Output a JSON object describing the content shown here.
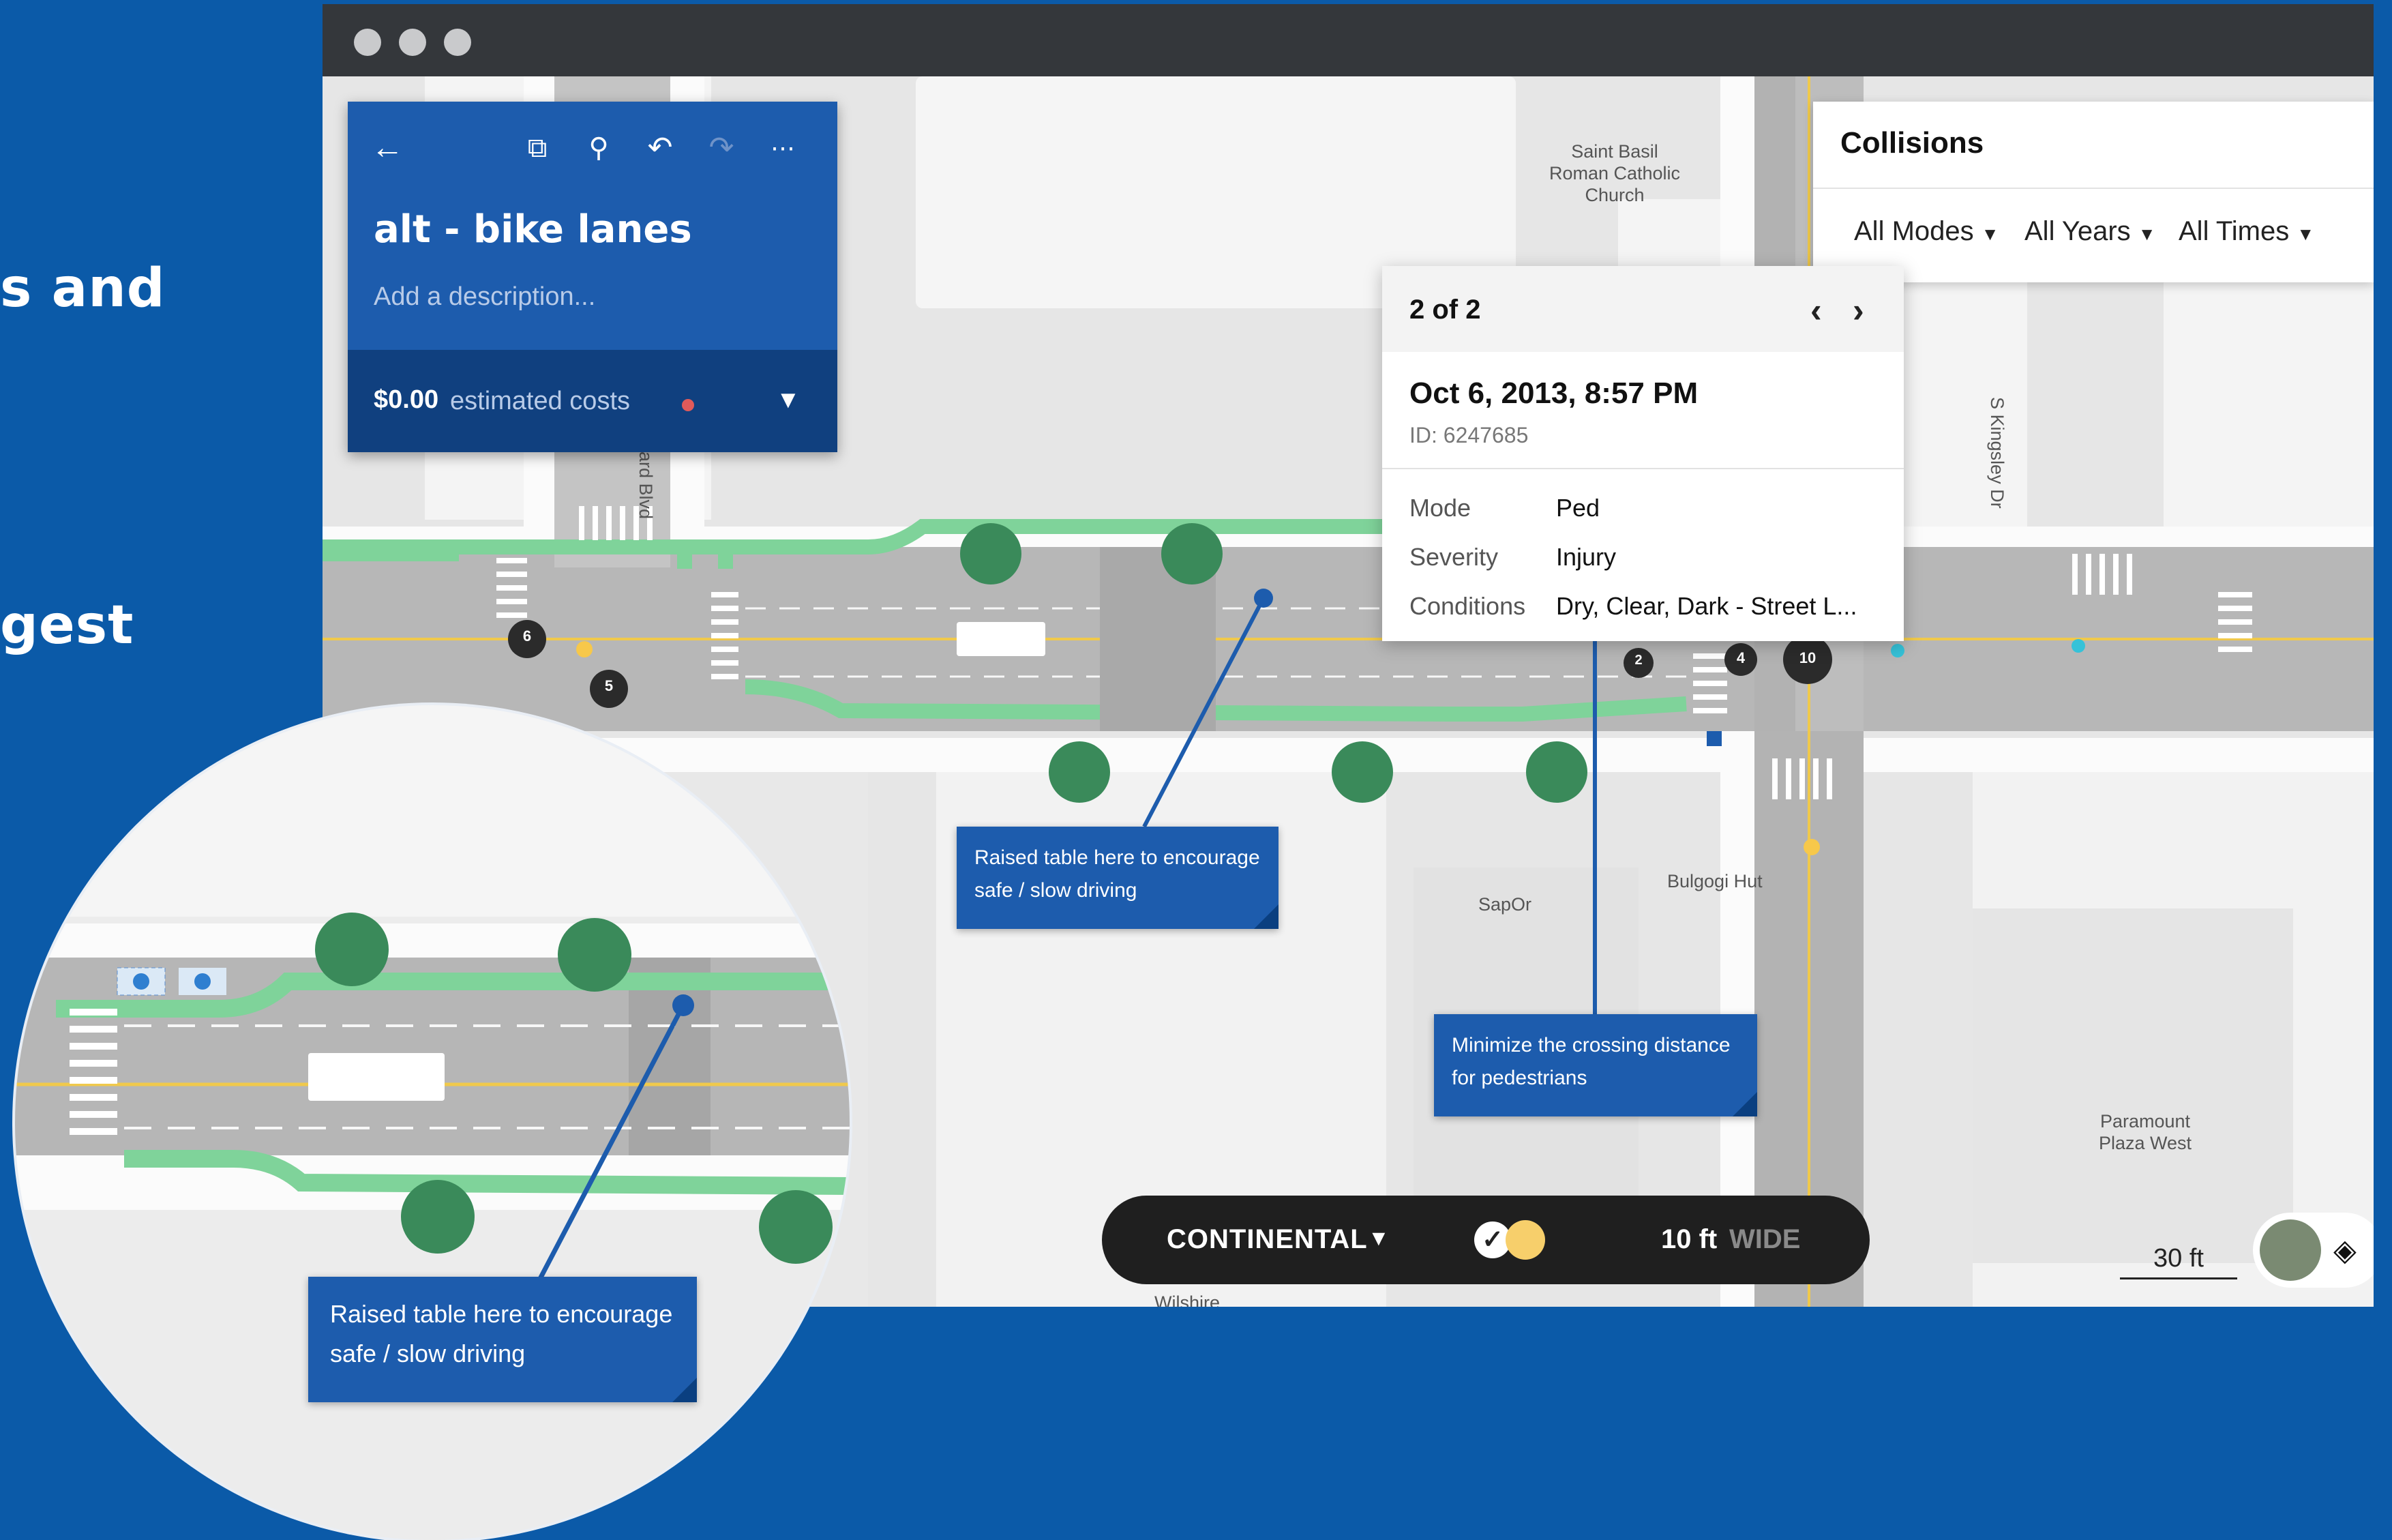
{
  "background_text": {
    "line1": "s and",
    "line2": "gest"
  },
  "project": {
    "back_icon": "arrow-left-icon",
    "toolbar_icons": [
      "duplicate-icon",
      "search-icon",
      "undo-icon",
      "redo-icon",
      "more-icon"
    ],
    "title": "alt - bike lanes",
    "description_placeholder": "Add a description...",
    "cost_value": "$0.00",
    "cost_label": "estimated costs"
  },
  "collisions": {
    "title": "Collisions",
    "filters": {
      "modes": "All Modes",
      "years": "All Years",
      "times": "All Times"
    }
  },
  "popup": {
    "count": "2 of 2",
    "date": "Oct 6, 2013, 8:57 PM",
    "id": "ID: 6247685",
    "rows": [
      {
        "key": "Mode",
        "value": "Ped"
      },
      {
        "key": "Severity",
        "value": "Injury"
      },
      {
        "key": "Conditions",
        "value": "Dry, Clear, Dark - Street L..."
      }
    ]
  },
  "notes": {
    "raised_table": "Raised table here to encourage safe / slow driving",
    "crossing": "Minimize the crossing distance for pedestrians"
  },
  "crosswalk": {
    "type": "CONTINENTAL",
    "width_value": "10 ft",
    "width_unit": "WIDE"
  },
  "scale": "30 ft",
  "map_labels": {
    "church": "Saint Basil Roman Catholic Church",
    "kingsley": "S Kingsley Dr",
    "blvd": "ard Blvd",
    "sapor": "SapOr",
    "bulgogi": "Bulgogi Hut",
    "paramount": "Paramount Plaza West",
    "wilshire": "Wilshire"
  },
  "collision_markers": [
    "6",
    "5",
    "2",
    "4",
    "10"
  ],
  "colors": {
    "brand_blue": "#1d5cad",
    "dark_blue": "#10407f",
    "bike_lane": "#7fd39a",
    "tree": "#3a8a5a",
    "background": "#0b5aa8"
  }
}
